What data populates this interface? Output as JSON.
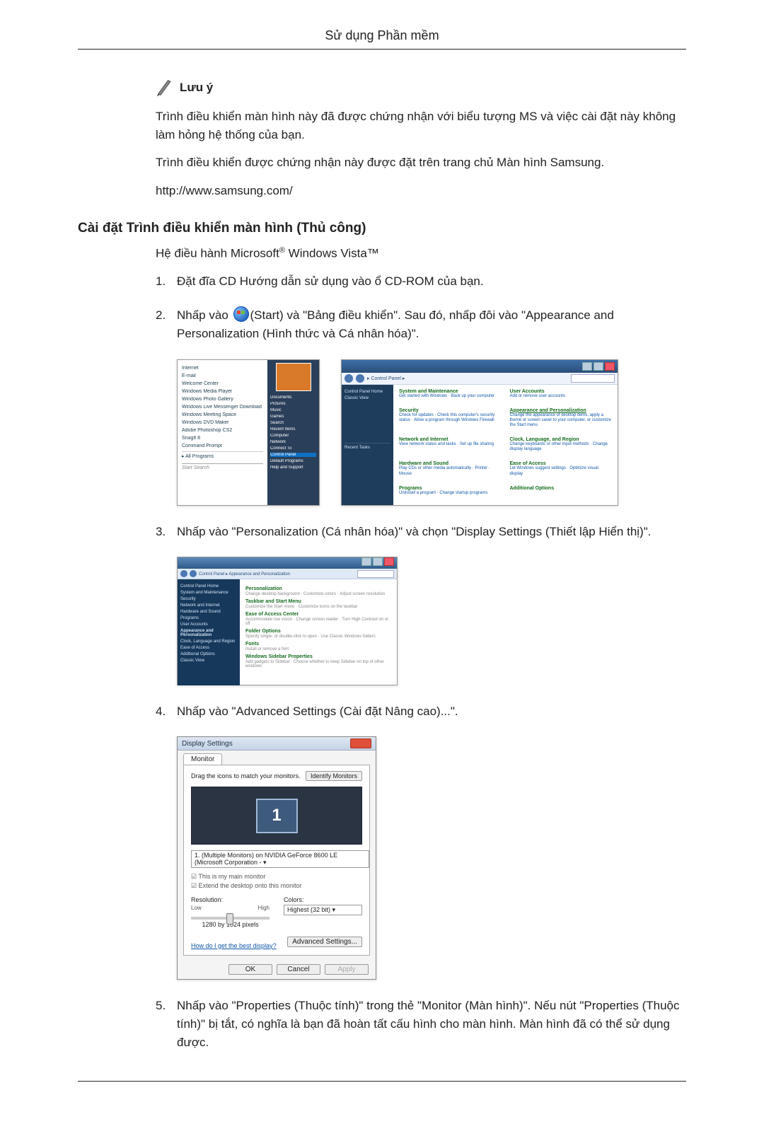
{
  "header": {
    "title": "Sử dụng Phần mềm"
  },
  "note": {
    "label": "Lưu ý",
    "p1": "Trình điều khiển màn hình này đã được chứng nhận với biểu tượng MS và việc cài đặt này không làm hỏng hệ thống của bạn.",
    "p2": "Trình điều khiển được chứng nhận này được đặt trên trang chủ Màn hình Samsung.",
    "p3": "http://www.samsung.com/"
  },
  "section": {
    "heading": "Cài đặt Trình điều khiển màn hình (Thủ công)",
    "intro_prefix": "Hệ điều hành Microsoft",
    "intro_suffix": " Windows Vista™"
  },
  "steps": {
    "s1_num": "1.",
    "s1": "Đặt đĩa CD Hướng dẫn sử dụng vào ổ CD-ROM của bạn.",
    "s2_num": "2.",
    "s2_a": "Nhấp vào ",
    "s2_b": "(Start) và \"Bảng điều khiển\". Sau đó, nhấp đôi vào \"Appearance and Personalization (Hình thức và Cá nhân hóa)\".",
    "s3_num": "3.",
    "s3": "Nhấp vào \"Personalization (Cá nhân hóa)\" và chọn \"Display Settings (Thiết lập Hiển thị)\".",
    "s4_num": "4.",
    "s4": "Nhấp vào \"Advanced Settings (Cài đặt Nâng cao)...\".",
    "s5_num": "5.",
    "s5": "Nhấp vào \"Properties (Thuộc tính)\" trong thẻ \"Monitor (Màn hình)\". Nếu nút \"Properties (Thuộc tính)\" bị tắt, có nghĩa là bạn đã hoàn tất cấu hình cho màn hình. Màn hình đã có thể sử dụng được."
  },
  "start_menu": {
    "left_items": [
      "Internet",
      "E-mail",
      "Welcome Center",
      "Windows Media Player",
      "Windows Photo Gallery",
      "Windows Live Messenger Download",
      "Windows Meeting Space",
      "Windows DVD Maker",
      "Adobe Photoshop CS2",
      "SnagIt 8",
      "Command Prompt"
    ],
    "all_programs": "All Programs",
    "search_placeholder": "Start Search",
    "right_items": [
      "Documents",
      "Pictures",
      "Music",
      "Games",
      "Search",
      "Recent Items",
      "Computer",
      "Network",
      "Connect To",
      "Control Panel",
      "Default Programs",
      "Help and Support"
    ]
  },
  "control_panel": {
    "breadcrumb": "Control Panel",
    "side": [
      "Control Panel Home",
      "Classic View"
    ],
    "side_recent": "Recent Tasks",
    "categories": [
      {
        "t": "System and Maintenance",
        "s": "Get started with Windows · Back up your computer"
      },
      {
        "t": "User Accounts",
        "s": "Add or remove user accounts"
      },
      {
        "t": "Security",
        "s": "Check for updates · Check this computer's security status · Allow a program through Windows Firewall"
      },
      {
        "t": "Appearance and Personalization",
        "s": "Change the appearance of desktop items, apply a theme or screen saver to your computer, or customize the Start menu"
      },
      {
        "t": "Network and Internet",
        "s": "View network status and tasks · Set up file sharing"
      },
      {
        "t": "Clock, Language, and Region",
        "s": "Change keyboards or other input methods · Change display language"
      },
      {
        "t": "Hardware and Sound",
        "s": "Play CDs or other media automatically · Printer · Mouse"
      },
      {
        "t": "Ease of Access",
        "s": "Let Windows suggest settings · Optimize visual display"
      },
      {
        "t": "Programs",
        "s": "Uninstall a program · Change startup programs"
      },
      {
        "t": "Additional Options",
        "s": ""
      }
    ]
  },
  "personalization": {
    "breadcrumb": "Control Panel ▸ Appearance and Personalization",
    "side": [
      "Control Panel Home",
      "System and Maintenance",
      "Security",
      "Network and Internet",
      "Hardware and Sound",
      "Programs",
      "User Accounts",
      "Appearance and Personalization",
      "Clock, Language and Region",
      "Ease of Access",
      "Additional Options",
      "Classic View"
    ],
    "items": [
      {
        "t": "Personalization",
        "s": "Change desktop background · Customize colors · Adjust screen resolution"
      },
      {
        "t": "Taskbar and Start Menu",
        "s": "Customize the Start menu · Customize icons on the taskbar"
      },
      {
        "t": "Ease of Access Center",
        "s": "Accommodate low vision · Change screen reader · Turn High Contrast on or off"
      },
      {
        "t": "Folder Options",
        "s": "Specify single- or double-click to open · Use Classic Windows folders"
      },
      {
        "t": "Fonts",
        "s": "Install or remove a font"
      },
      {
        "t": "Windows Sidebar Properties",
        "s": "Add gadgets to Sidebar · Choose whether to keep Sidebar on top of other windows"
      }
    ]
  },
  "display_settings": {
    "title": "Display Settings",
    "tab": "Monitor",
    "drag_label": "Drag the icons to match your monitors.",
    "identify_btn": "Identify Monitors",
    "monitor_number": "1",
    "device": "1. (Multiple Monitors) on NVIDIA GeForce 8600 LE (Microsoft Corporation - ▾",
    "check1": "This is my main monitor",
    "check2": "Extend the desktop onto this monitor",
    "res_label": "Resolution:",
    "low": "Low",
    "high": "High",
    "res_value": "1280 by 1024 pixels",
    "colors_label": "Colors:",
    "colors_value": "Highest (32 bit)",
    "help_link": "How do I get the best display?",
    "adv_btn": "Advanced Settings...",
    "ok": "OK",
    "cancel": "Cancel",
    "apply": "Apply"
  }
}
